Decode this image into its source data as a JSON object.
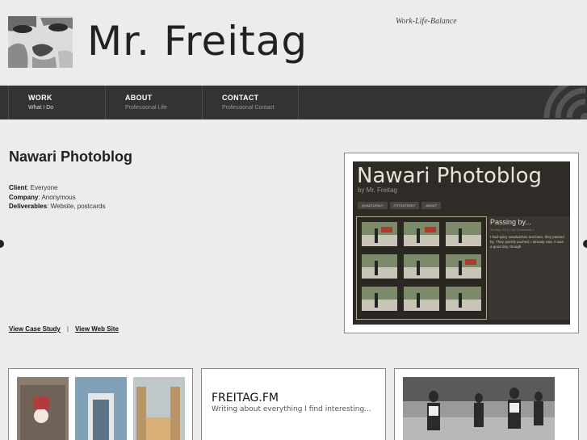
{
  "header": {
    "site_title": "Mr. Freitag",
    "tagline": "Work-Life-Balance"
  },
  "nav": {
    "items": [
      {
        "label": "WORK",
        "sub": "What I Do"
      },
      {
        "label": "ABOUT",
        "sub": "Professional Life"
      },
      {
        "label": "CONTACT",
        "sub": "Professional Contact"
      }
    ]
  },
  "project": {
    "title": "Nawari Photoblog",
    "client_label": "Client",
    "client_value": ": Everyone",
    "company_label": "Company",
    "company_value": ": Anonymous",
    "deliverables_label": "Deliverables",
    "deliverables_value": ": Website, postcards",
    "link_case_study": "View Case Study",
    "link_separator": "|",
    "link_website": "View Web Site"
  },
  "screenshot": {
    "title": "Nawari Photoblog",
    "byline": "by Mr. Freitag",
    "nav": [
      "QUADTUPALY",
      "FOTOSTREET",
      "ABOUT"
    ],
    "post_title": "Passing by...",
    "post_meta": "24 May 2010 | No Comments »",
    "post_body": "I had spicy sandwiches and beer, they passed by. They quickly pushed, I already saw. It was a good day, though."
  },
  "thumbs": {
    "freitag_title": "FREITAG.FM",
    "freitag_sub": "Writing about everything I find interesting..."
  }
}
